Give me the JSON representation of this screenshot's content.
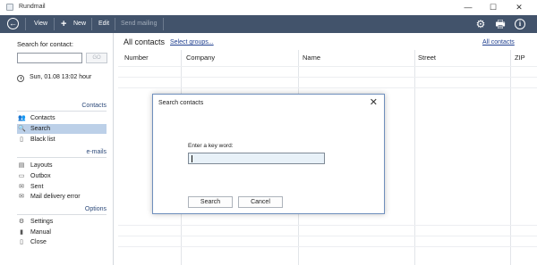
{
  "window": {
    "title": "Rundmail",
    "minimize_glyph": "—",
    "maximize_glyph": "☐",
    "close_glyph": "✕"
  },
  "toolbar": {
    "back_glyph": "←",
    "view_label": "View",
    "new_label": "New",
    "new_glyph": "+",
    "edit_label": "Edit",
    "send_label": "Send mailing",
    "settings_glyph": "⚙",
    "print_glyph": "🖶",
    "info_glyph": "i"
  },
  "sidebar": {
    "search_label": "Search for contact:",
    "search_value": "",
    "go_label": "GO",
    "datetime": "Sun, 01.08   13:02 hour",
    "sections": [
      {
        "title": "Contacts",
        "items": [
          {
            "label": "Contacts",
            "icon": "contacts-icon",
            "glyph": "👥"
          },
          {
            "label": "Search",
            "icon": "search-icon",
            "glyph": "🔍"
          },
          {
            "label": "Black list",
            "icon": "blacklist-icon",
            "glyph": "▯"
          }
        ]
      },
      {
        "title": "e-mails",
        "items": [
          {
            "label": "Layouts",
            "icon": "layouts-icon",
            "glyph": "▤"
          },
          {
            "label": "Outbox",
            "icon": "outbox-icon",
            "glyph": "▭"
          },
          {
            "label": "Sent",
            "icon": "sent-icon",
            "glyph": "✉"
          },
          {
            "label": "Mail delivery error",
            "icon": "mail-error-icon",
            "glyph": "✉"
          }
        ]
      },
      {
        "title": "Options",
        "items": [
          {
            "label": "Settings",
            "icon": "gear-icon",
            "glyph": "⚙"
          },
          {
            "label": "Manual",
            "icon": "manual-icon",
            "glyph": "▮"
          },
          {
            "label": "Close",
            "icon": "close-icon",
            "glyph": "▯"
          }
        ]
      }
    ]
  },
  "main": {
    "title": "All contacts",
    "select_groups_link": "Select groups...",
    "all_contacts_link": "All contacts",
    "columns": [
      "Number",
      "Company",
      "Name",
      "Street",
      "ZIP"
    ]
  },
  "dialog": {
    "title": "Search contacts",
    "close_glyph": "✕",
    "keyword_label": "Enter a key word:",
    "keyword_value": "",
    "search_button": "Search",
    "cancel_button": "Cancel"
  },
  "colors": {
    "toolbar_bg": "#42536b",
    "selected_nav_bg": "#bcd0e8",
    "link": "#1f3f8f",
    "dialog_border": "#6f8fbd"
  }
}
